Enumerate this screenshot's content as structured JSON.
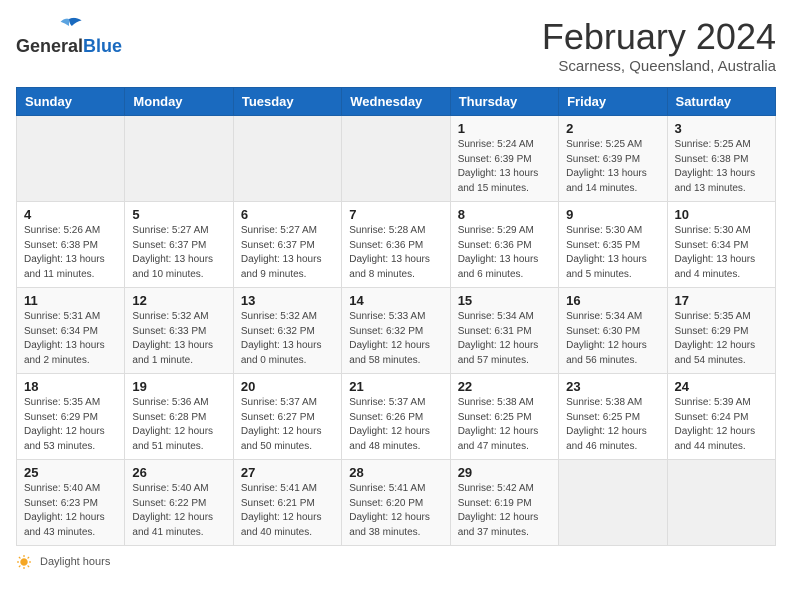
{
  "header": {
    "logo_general": "General",
    "logo_blue": "Blue",
    "title": "February 2024",
    "subtitle": "Scarness, Queensland, Australia"
  },
  "days_of_week": [
    "Sunday",
    "Monday",
    "Tuesday",
    "Wednesday",
    "Thursday",
    "Friday",
    "Saturday"
  ],
  "weeks": [
    [
      {
        "day": "",
        "info": ""
      },
      {
        "day": "",
        "info": ""
      },
      {
        "day": "",
        "info": ""
      },
      {
        "day": "",
        "info": ""
      },
      {
        "day": "1",
        "info": "Sunrise: 5:24 AM\nSunset: 6:39 PM\nDaylight: 13 hours\nand 15 minutes."
      },
      {
        "day": "2",
        "info": "Sunrise: 5:25 AM\nSunset: 6:39 PM\nDaylight: 13 hours\nand 14 minutes."
      },
      {
        "day": "3",
        "info": "Sunrise: 5:25 AM\nSunset: 6:38 PM\nDaylight: 13 hours\nand 13 minutes."
      }
    ],
    [
      {
        "day": "4",
        "info": "Sunrise: 5:26 AM\nSunset: 6:38 PM\nDaylight: 13 hours\nand 11 minutes."
      },
      {
        "day": "5",
        "info": "Sunrise: 5:27 AM\nSunset: 6:37 PM\nDaylight: 13 hours\nand 10 minutes."
      },
      {
        "day": "6",
        "info": "Sunrise: 5:27 AM\nSunset: 6:37 PM\nDaylight: 13 hours\nand 9 minutes."
      },
      {
        "day": "7",
        "info": "Sunrise: 5:28 AM\nSunset: 6:36 PM\nDaylight: 13 hours\nand 8 minutes."
      },
      {
        "day": "8",
        "info": "Sunrise: 5:29 AM\nSunset: 6:36 PM\nDaylight: 13 hours\nand 6 minutes."
      },
      {
        "day": "9",
        "info": "Sunrise: 5:30 AM\nSunset: 6:35 PM\nDaylight: 13 hours\nand 5 minutes."
      },
      {
        "day": "10",
        "info": "Sunrise: 5:30 AM\nSunset: 6:34 PM\nDaylight: 13 hours\nand 4 minutes."
      }
    ],
    [
      {
        "day": "11",
        "info": "Sunrise: 5:31 AM\nSunset: 6:34 PM\nDaylight: 13 hours\nand 2 minutes."
      },
      {
        "day": "12",
        "info": "Sunrise: 5:32 AM\nSunset: 6:33 PM\nDaylight: 13 hours\nand 1 minute."
      },
      {
        "day": "13",
        "info": "Sunrise: 5:32 AM\nSunset: 6:32 PM\nDaylight: 13 hours\nand 0 minutes."
      },
      {
        "day": "14",
        "info": "Sunrise: 5:33 AM\nSunset: 6:32 PM\nDaylight: 12 hours\nand 58 minutes."
      },
      {
        "day": "15",
        "info": "Sunrise: 5:34 AM\nSunset: 6:31 PM\nDaylight: 12 hours\nand 57 minutes."
      },
      {
        "day": "16",
        "info": "Sunrise: 5:34 AM\nSunset: 6:30 PM\nDaylight: 12 hours\nand 56 minutes."
      },
      {
        "day": "17",
        "info": "Sunrise: 5:35 AM\nSunset: 6:29 PM\nDaylight: 12 hours\nand 54 minutes."
      }
    ],
    [
      {
        "day": "18",
        "info": "Sunrise: 5:35 AM\nSunset: 6:29 PM\nDaylight: 12 hours\nand 53 minutes."
      },
      {
        "day": "19",
        "info": "Sunrise: 5:36 AM\nSunset: 6:28 PM\nDaylight: 12 hours\nand 51 minutes."
      },
      {
        "day": "20",
        "info": "Sunrise: 5:37 AM\nSunset: 6:27 PM\nDaylight: 12 hours\nand 50 minutes."
      },
      {
        "day": "21",
        "info": "Sunrise: 5:37 AM\nSunset: 6:26 PM\nDaylight: 12 hours\nand 48 minutes."
      },
      {
        "day": "22",
        "info": "Sunrise: 5:38 AM\nSunset: 6:25 PM\nDaylight: 12 hours\nand 47 minutes."
      },
      {
        "day": "23",
        "info": "Sunrise: 5:38 AM\nSunset: 6:25 PM\nDaylight: 12 hours\nand 46 minutes."
      },
      {
        "day": "24",
        "info": "Sunrise: 5:39 AM\nSunset: 6:24 PM\nDaylight: 12 hours\nand 44 minutes."
      }
    ],
    [
      {
        "day": "25",
        "info": "Sunrise: 5:40 AM\nSunset: 6:23 PM\nDaylight: 12 hours\nand 43 minutes."
      },
      {
        "day": "26",
        "info": "Sunrise: 5:40 AM\nSunset: 6:22 PM\nDaylight: 12 hours\nand 41 minutes."
      },
      {
        "day": "27",
        "info": "Sunrise: 5:41 AM\nSunset: 6:21 PM\nDaylight: 12 hours\nand 40 minutes."
      },
      {
        "day": "28",
        "info": "Sunrise: 5:41 AM\nSunset: 6:20 PM\nDaylight: 12 hours\nand 38 minutes."
      },
      {
        "day": "29",
        "info": "Sunrise: 5:42 AM\nSunset: 6:19 PM\nDaylight: 12 hours\nand 37 minutes."
      },
      {
        "day": "",
        "info": ""
      },
      {
        "day": "",
        "info": ""
      }
    ]
  ],
  "footer": {
    "daylight_label": "Daylight hours"
  }
}
